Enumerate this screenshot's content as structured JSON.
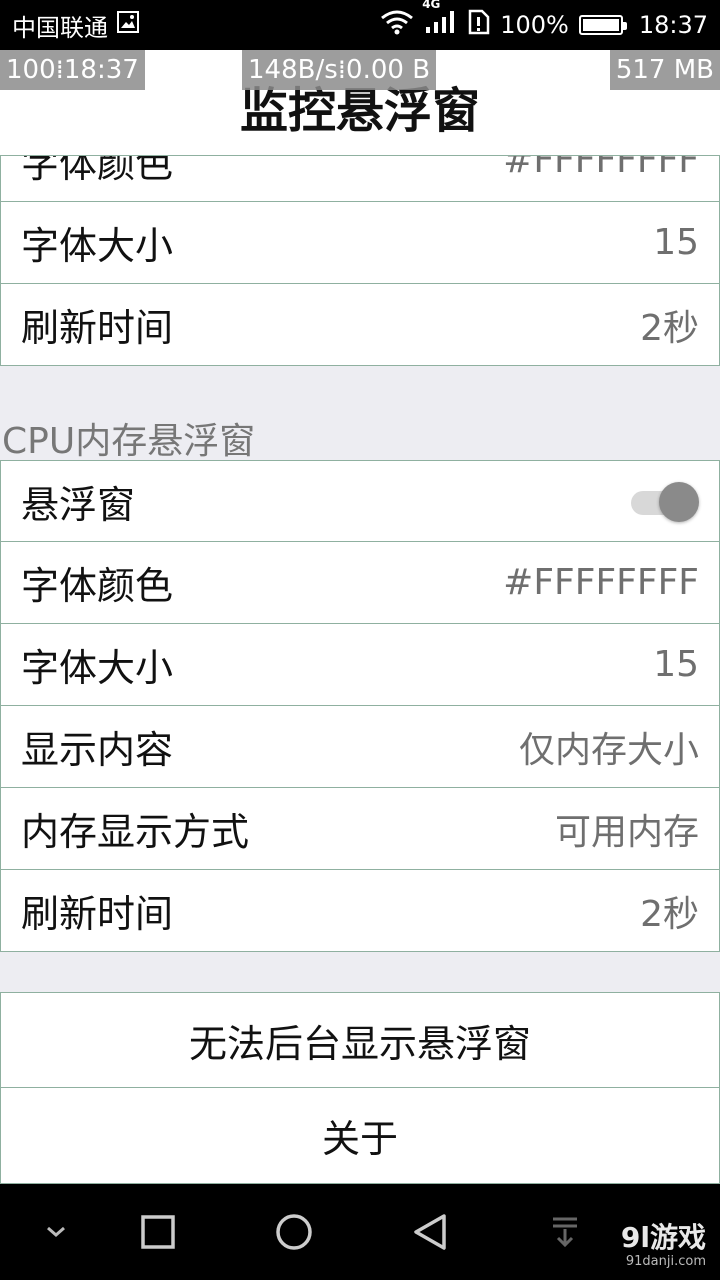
{
  "status_bar": {
    "carrier": "中国联通",
    "network": "4G",
    "battery": "100%",
    "time": "18:37"
  },
  "overlay": {
    "left": "100⁞18:37",
    "middle": "148B/s⁞0.00 B",
    "right": "517 MB"
  },
  "page_title": "监控悬浮窗",
  "top_section": {
    "partial_row": {
      "label": "字体颜色",
      "value": "#FFFFFFFF"
    },
    "rows": [
      {
        "label": "字体大小",
        "value": "15"
      },
      {
        "label": "刷新时间",
        "value": "2秒"
      }
    ]
  },
  "cpu_section": {
    "title": "CPU内存悬浮窗",
    "toggle_row": {
      "label": "悬浮窗",
      "enabled": true
    },
    "rows": [
      {
        "label": "字体颜色",
        "value": "#FFFFFFFF"
      },
      {
        "label": "字体大小",
        "value": "15"
      },
      {
        "label": "显示内容",
        "value": "仅内存大小"
      },
      {
        "label": "内存显示方式",
        "value": "可用内存"
      },
      {
        "label": "刷新时间",
        "value": "2秒"
      }
    ]
  },
  "buttons": {
    "background_issue": "无法后台显示悬浮窗",
    "about": "关于"
  },
  "watermark": {
    "brand": "9l游戏",
    "site": "91danji.com"
  },
  "colors": {
    "divider": "#8fb0a0",
    "background": "#ededf2",
    "value_text": "#6f6f6f"
  }
}
